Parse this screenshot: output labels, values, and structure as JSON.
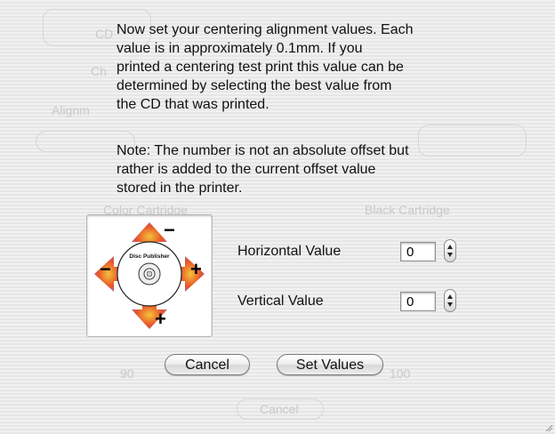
{
  "dialog": {
    "message": "Now set your centering alignment values.  Each\nvalue is in approximately 0.1mm.  If you\nprinted a centering test print this value can be\ndetermined by selecting the best value from\nthe CD that was printed.",
    "note": "Note:  The number is not an absolute offset but\nrather is added to the current offset value\nstored in the printer.",
    "image": {
      "icon": "cd-alignment-arrows-icon",
      "disc_label": "Disc Publisher",
      "plus_sign": "+",
      "minus_sign": "−"
    },
    "horizontal": {
      "label": "Horizontal Value",
      "value": "0"
    },
    "vertical": {
      "label": "Vertical Value",
      "value": "0"
    },
    "buttons": {
      "cancel": "Cancel",
      "set_values": "Set Values"
    }
  },
  "background_window": {
    "labels": {
      "cd": "CD",
      "ch": "Ch",
      "alignment": "Alignm",
      "color_cartridge": "Color Cartridge",
      "black_cartridge": "Black Cartridge",
      "level_left": "90",
      "level_right": "100",
      "cancel": "Cancel"
    }
  },
  "colors": {
    "arrow_orange": "#e8542a",
    "arrow_yellow": "#f4a21c",
    "arrow_purple": "#9b6fb0"
  }
}
